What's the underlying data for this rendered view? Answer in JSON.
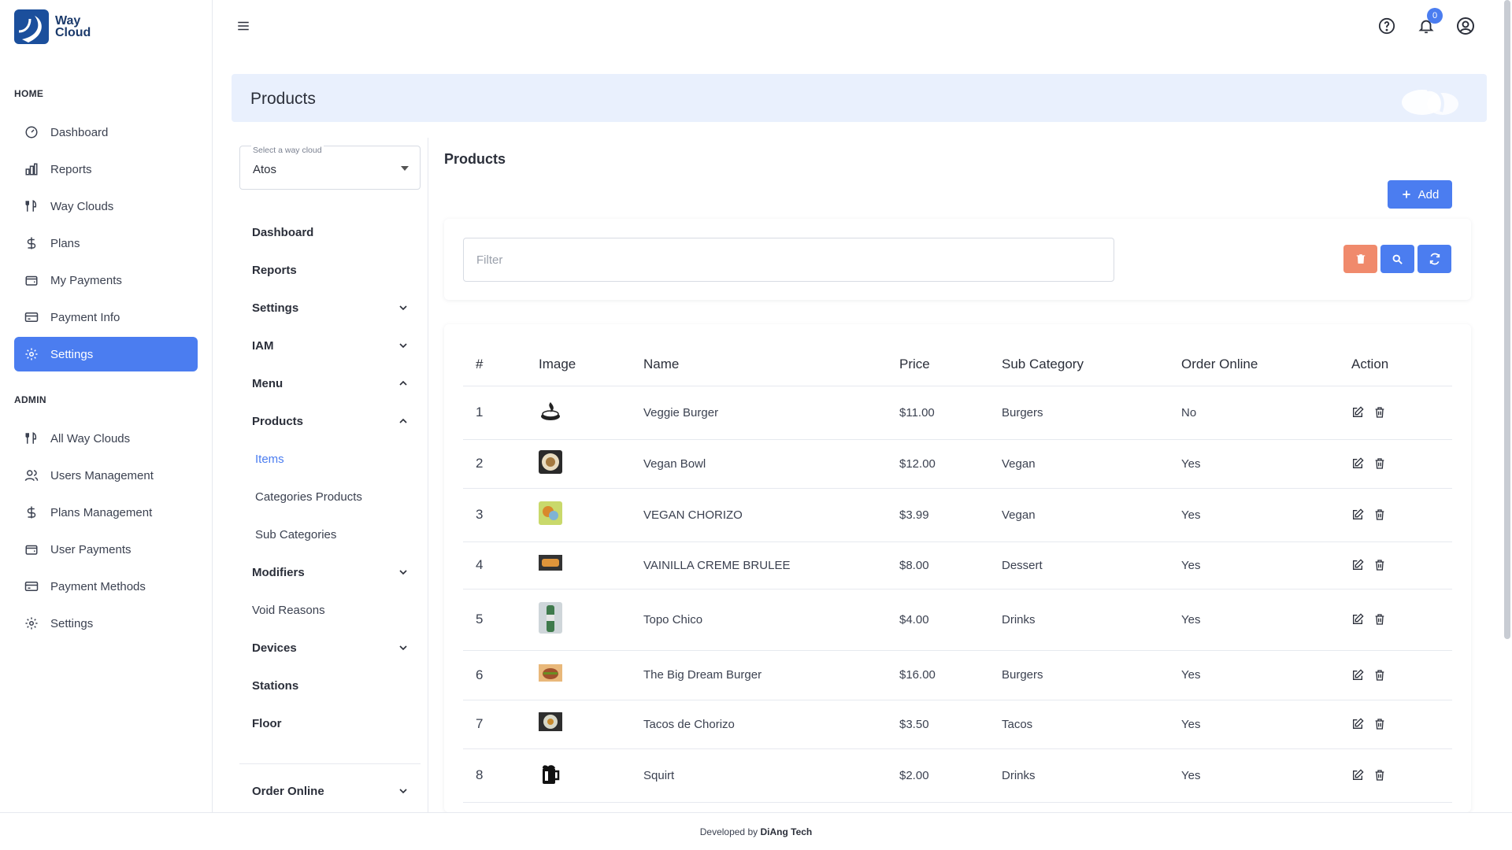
{
  "brand": {
    "line1": "Way",
    "line2": "Cloud"
  },
  "sidebar": {
    "home_label": "HOME",
    "home_items": [
      {
        "label": "Dashboard",
        "icon": "dashboard-icon"
      },
      {
        "label": "Reports",
        "icon": "bar-chart-icon"
      },
      {
        "label": "Way Clouds",
        "icon": "utensils-icon"
      },
      {
        "label": "Plans",
        "icon": "dollar-icon"
      },
      {
        "label": "My Payments",
        "icon": "wallet-icon"
      },
      {
        "label": "Payment Info",
        "icon": "credit-card-icon"
      },
      {
        "label": "Settings",
        "icon": "gear-icon",
        "active": true
      }
    ],
    "admin_label": "ADMIN",
    "admin_items": [
      {
        "label": "All Way Clouds",
        "icon": "utensils-icon"
      },
      {
        "label": "Users Management",
        "icon": "users-icon"
      },
      {
        "label": "Plans Management",
        "icon": "dollar-icon"
      },
      {
        "label": "User Payments",
        "icon": "wallet-icon"
      },
      {
        "label": "Payment Methods",
        "icon": "credit-card-icon"
      },
      {
        "label": "Settings",
        "icon": "gear-icon"
      }
    ]
  },
  "topbar": {
    "notification_count": "0"
  },
  "page": {
    "title": "Products"
  },
  "subnav": {
    "select_label": "Select a way cloud",
    "select_value": "Atos",
    "items": {
      "dashboard": "Dashboard",
      "reports": "Reports",
      "settings": "Settings",
      "iam": "IAM",
      "menu": "Menu",
      "products": "Products",
      "items": "Items",
      "categories_products": "Categories Products",
      "sub_categories": "Sub Categories",
      "modifiers": "Modifiers",
      "void_reasons": "Void Reasons",
      "devices": "Devices",
      "stations": "Stations",
      "floor": "Floor",
      "order_online": "Order Online"
    }
  },
  "main": {
    "title": "Products",
    "add_label": "Add",
    "filter_placeholder": "Filter"
  },
  "table": {
    "headers": [
      "#",
      "Image",
      "Name",
      "Price",
      "Sub Category",
      "Order Online",
      "Action"
    ],
    "rows": [
      {
        "n": "1",
        "name": "Veggie Burger",
        "price": "$11.00",
        "sub": "Burgers",
        "online": "No"
      },
      {
        "n": "2",
        "name": "Vegan Bowl",
        "price": "$12.00",
        "sub": "Vegan",
        "online": "Yes"
      },
      {
        "n": "3",
        "name": "VEGAN CHORIZO",
        "price": "$3.99",
        "sub": "Vegan",
        "online": "Yes"
      },
      {
        "n": "4",
        "name": "VAINILLA CREME BRULEE",
        "price": "$8.00",
        "sub": "Dessert",
        "online": "Yes"
      },
      {
        "n": "5",
        "name": "Topo Chico",
        "price": "$4.00",
        "sub": "Drinks",
        "online": "Yes"
      },
      {
        "n": "6",
        "name": "The Big Dream Burger",
        "price": "$16.00",
        "sub": "Burgers",
        "online": "Yes"
      },
      {
        "n": "7",
        "name": "Tacos de Chorizo",
        "price": "$3.50",
        "sub": "Tacos",
        "online": "Yes"
      },
      {
        "n": "8",
        "name": "Squirt",
        "price": "$2.00",
        "sub": "Drinks",
        "online": "Yes"
      }
    ]
  },
  "footer": {
    "prefix": "Developed by",
    "brand": "DiAng Tech"
  },
  "colors": {
    "accent": "#4b7df0",
    "danger": "#f08a6c",
    "header_bg": "#e9f0fd"
  }
}
